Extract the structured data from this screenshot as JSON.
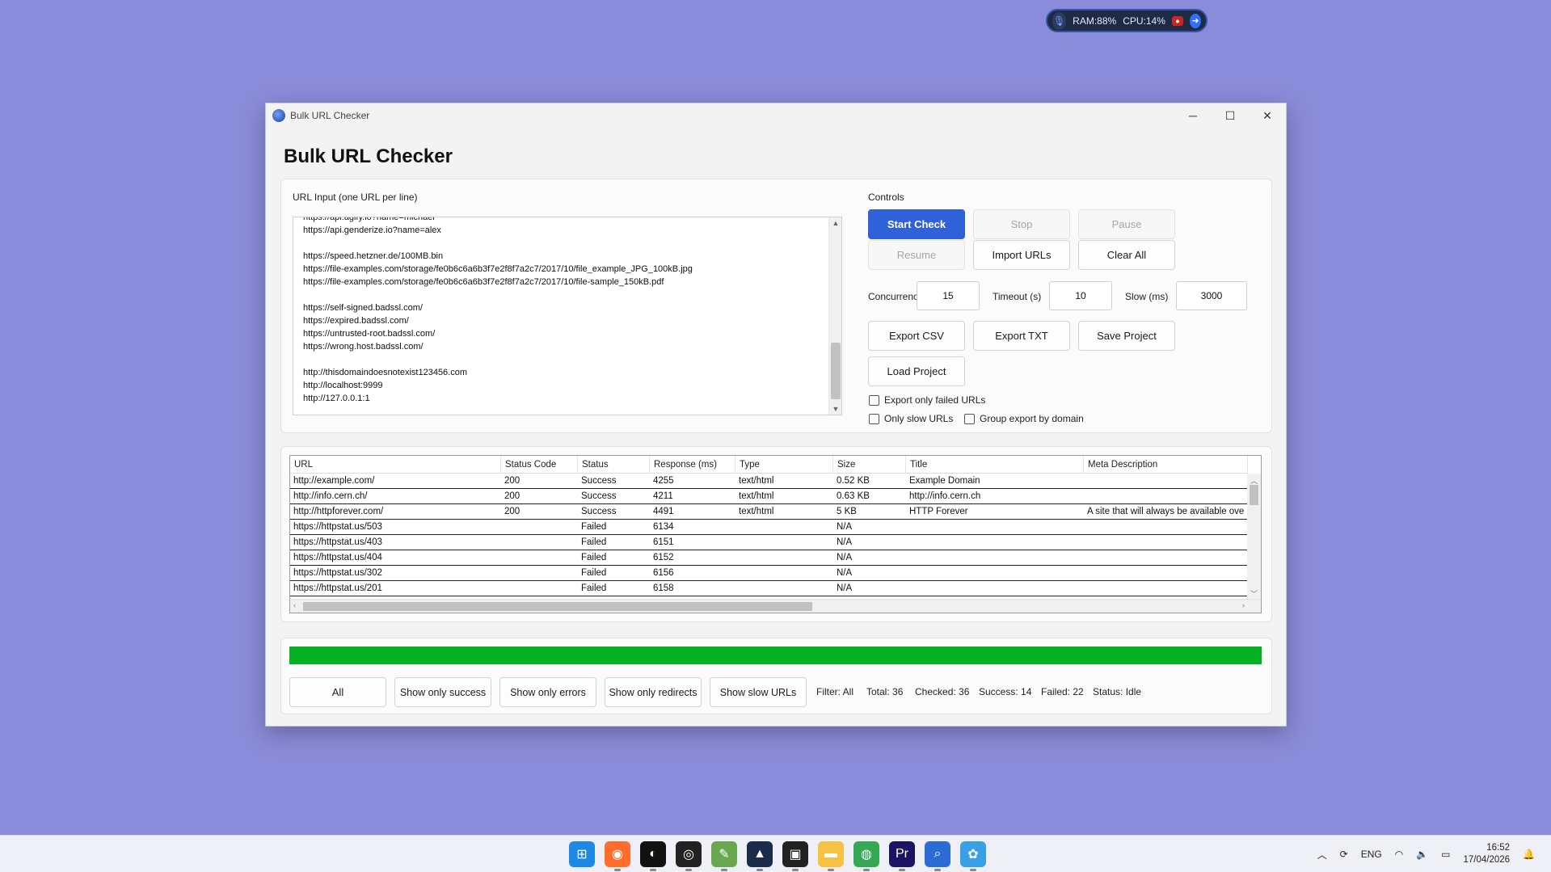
{
  "overlay": {
    "ram": "RAM:88%",
    "cpu": "CPU:14%",
    "mic_icon": "microphone-icon",
    "rec_icon": "record-icon",
    "go_icon": "arrow-right-icon"
  },
  "window": {
    "title": "Bulk URL Checker",
    "heading": "Bulk URL Checker",
    "controls": {
      "minimize": "─",
      "maximize": "☐",
      "close": "✕"
    }
  },
  "input": {
    "label": "URL Input (one URL per line)",
    "lines": [
      "https://api.agify.io?name=michael",
      "https://api.genderize.io?name=alex",
      "",
      "https://speed.hetzner.de/100MB.bin",
      "https://file-examples.com/storage/fe0b6c6a6b3f7e2f8f7a2c7/2017/10/file_example_JPG_100kB.jpg",
      "https://file-examples.com/storage/fe0b6c6a6b3f7e2f8f7a2c7/2017/10/file-sample_150kB.pdf",
      "",
      "https://self-signed.badssl.com/",
      "https://expired.badssl.com/",
      "https://untrusted-root.badssl.com/",
      "https://wrong.host.badssl.com/",
      "",
      "http://thisdomaindoesnotexist123456.com",
      "http://localhost:9999",
      "http://127.0.0.1:1"
    ]
  },
  "controls": {
    "label": "Controls",
    "start": "Start Check",
    "stop": "Stop",
    "pause": "Pause",
    "resume": "Resume",
    "import": "Import URLs",
    "clear": "Clear All",
    "concurrency_label": "Concurrency",
    "concurrency_value": "15",
    "timeout_label": "Timeout (s)",
    "timeout_value": "10",
    "slow_label": "Slow (ms)",
    "slow_value": "3000",
    "export_csv": "Export CSV",
    "export_txt": "Export TXT",
    "save_project": "Save Project",
    "load_project": "Load Project",
    "chk_failed": "Export only failed URLs",
    "chk_slow": "Only slow URLs",
    "chk_group": "Group export by domain"
  },
  "table": {
    "columns": [
      "URL",
      "Status Code",
      "Status",
      "Response (ms)",
      "Type",
      "Size",
      "Title",
      "Meta Description"
    ],
    "rows": [
      [
        "http://example.com/",
        "200",
        "Success",
        "4255",
        "text/html",
        "0.52 KB",
        "Example Domain",
        ""
      ],
      [
        "http://info.cern.ch/",
        "200",
        "Success",
        "4211",
        "text/html",
        "0.63 KB",
        "http://info.cern.ch",
        ""
      ],
      [
        "http://httpforever.com/",
        "200",
        "Success",
        "4491",
        "text/html",
        "5 KB",
        "HTTP Forever",
        "A site that will always be available ove"
      ],
      [
        "https://httpstat.us/503",
        "",
        "Failed",
        "6134",
        "",
        "N/A",
        "",
        ""
      ],
      [
        "https://httpstat.us/403",
        "",
        "Failed",
        "6151",
        "",
        "N/A",
        "",
        ""
      ],
      [
        "https://httpstat.us/404",
        "",
        "Failed",
        "6152",
        "",
        "N/A",
        "",
        ""
      ],
      [
        "https://httpstat.us/302",
        "",
        "Failed",
        "6156",
        "",
        "N/A",
        "",
        ""
      ],
      [
        "https://httpstat.us/201",
        "",
        "Failed",
        "6158",
        "",
        "N/A",
        "",
        ""
      ]
    ]
  },
  "progress": {
    "fraction": 1.0,
    "color": "#06b025"
  },
  "filters": {
    "all": "All",
    "success": "Show only success",
    "errors": "Show only errors",
    "redirects": "Show only redirects",
    "slow": "Show slow URLs"
  },
  "stats": {
    "filter": "Filter: All",
    "total": "Total: 36",
    "checked": "Checked: 36",
    "success": "Success: 14",
    "failed": "Failed: 22",
    "status": "Status: Idle"
  },
  "taskbar": {
    "apps": [
      {
        "icon": "windows-start-icon",
        "color": "#1e88e5"
      },
      {
        "icon": "firefox-icon",
        "color": "#ff6d2d"
      },
      {
        "icon": "app-icon",
        "color": "#111111"
      },
      {
        "icon": "obs-icon",
        "color": "#222222"
      },
      {
        "icon": "notepad-icon",
        "color": "#6aa84f"
      },
      {
        "icon": "vector-app-icon",
        "color": "#1a2b4c"
      },
      {
        "icon": "terminal-icon",
        "color": "#222222"
      },
      {
        "icon": "file-explorer-icon",
        "color": "#f5c242"
      },
      {
        "icon": "chrome-icon",
        "color": "#34a853"
      },
      {
        "icon": "premiere-icon",
        "color": "#1b1463"
      },
      {
        "icon": "search-app-icon",
        "color": "#2b6cd4"
      },
      {
        "icon": "web-app-icon",
        "color": "#3aa0e6"
      }
    ],
    "lang": "ENG",
    "time": "16:52",
    "date": "17/04/2026"
  }
}
